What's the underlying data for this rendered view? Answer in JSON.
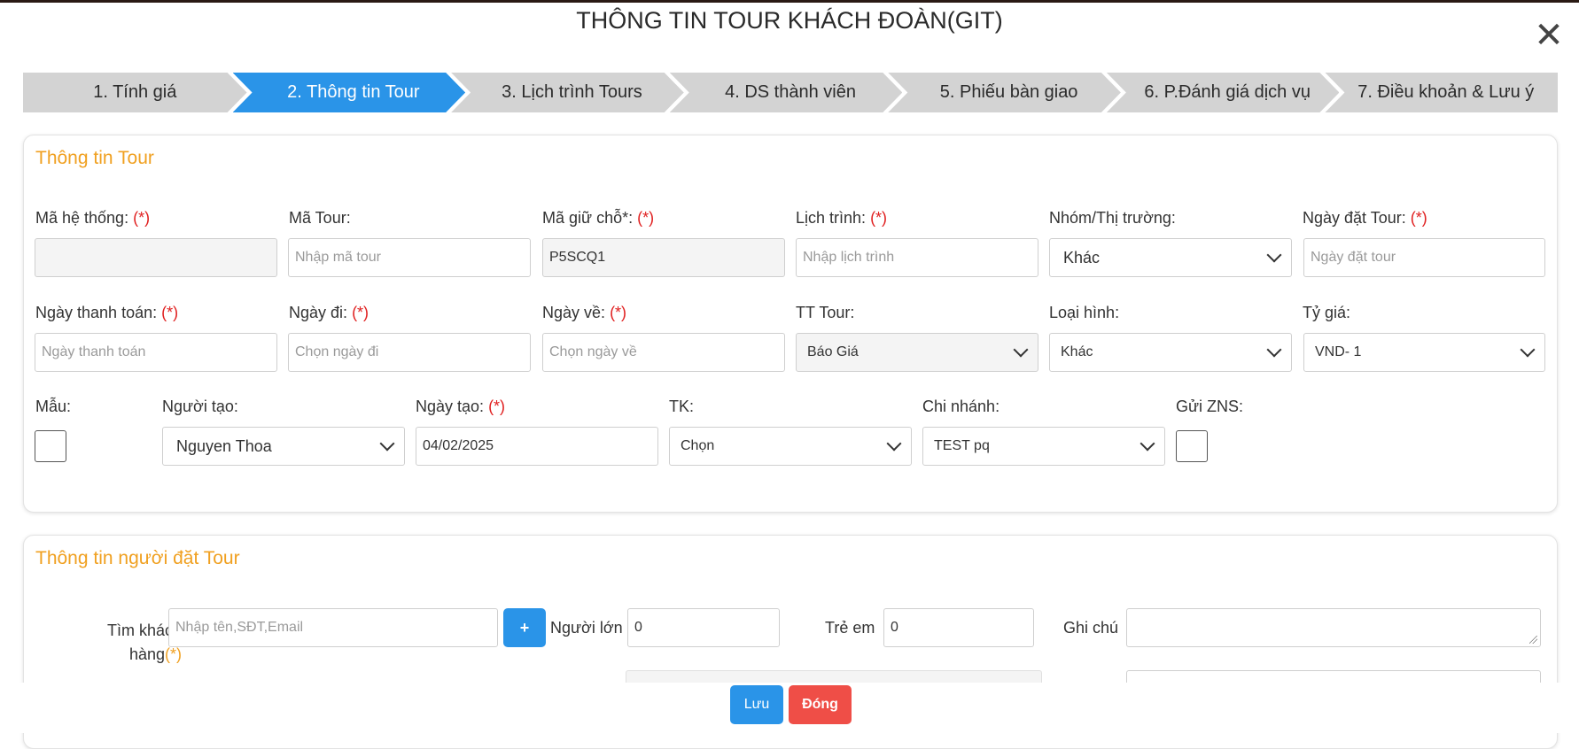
{
  "title": "THÔNG TIN TOUR KHÁCH ĐOÀN(GIT)",
  "close_glyph": "✕",
  "steps": [
    {
      "label": "1. Tính giá"
    },
    {
      "label": "2. Thông tin Tour"
    },
    {
      "label": "3. Lịch trình Tours"
    },
    {
      "label": "4. DS thành viên"
    },
    {
      "label": "5. Phiếu bàn giao"
    },
    {
      "label": "6. P.Đánh giá dịch vụ"
    },
    {
      "label": "7. Điều khoản & Lưu ý"
    }
  ],
  "active_step": 2,
  "required_mark": "(*)",
  "tour_info": {
    "title": "Thông tin Tour",
    "ma_he_thong": {
      "label": "Mã hệ thống:",
      "value": ""
    },
    "ma_tour": {
      "label": "Mã Tour:",
      "placeholder": "Nhập mã tour"
    },
    "ma_giu_cho": {
      "label": "Mã giữ chỗ*:",
      "value": "P5SCQ1"
    },
    "lich_trinh": {
      "label": "Lịch trình:",
      "placeholder": "Nhập lịch trình"
    },
    "nhom_thi_truong": {
      "label": "Nhóm/Thị trường:",
      "value": "Khác"
    },
    "ngay_dat_tour": {
      "label": "Ngày đặt Tour:",
      "placeholder": "Ngày đặt tour"
    },
    "ngay_thanh_toan": {
      "label": "Ngày thanh toán:",
      "placeholder": "Ngày thanh toán"
    },
    "ngay_di": {
      "label": "Ngày đi:",
      "placeholder": "Chọn ngày đi"
    },
    "ngay_ve": {
      "label": "Ngày về:",
      "placeholder": "Chọn ngày về"
    },
    "tt_tour": {
      "label": "TT Tour:",
      "value": "Báo Giá"
    },
    "loai_hinh": {
      "label": "Loại hình:",
      "value": "Khác"
    },
    "ty_gia": {
      "label": "Tỷ giá:",
      "value": "VND- 1"
    },
    "mau": {
      "label": "Mẫu:"
    },
    "nguoi_tao": {
      "label": "Người tạo:",
      "value": "Nguyen Thoa"
    },
    "ngay_tao": {
      "label": "Ngày tạo:",
      "value": "04/02/2025"
    },
    "tk": {
      "label": "TK:",
      "value": "Chọn"
    },
    "chi_nhanh": {
      "label": "Chi nhánh:",
      "value": "TEST pq"
    },
    "gui_zns": {
      "label": "Gửi ZNS:"
    }
  },
  "booker_info": {
    "title": "Thông tin người đặt Tour",
    "tim_khach_hang": {
      "label_line1": "Tìm khách",
      "label_line2": "hàng",
      "placeholder": "Nhập tên,SĐT,Email"
    },
    "plus_label": "+",
    "nguoi_lon": {
      "label": "Người lớn",
      "value": "0"
    },
    "tre_em": {
      "label": "Trẻ em",
      "value": "0"
    },
    "ghi_chu": {
      "label": "Ghi chú"
    }
  },
  "footer": {
    "save_label": "Lưu",
    "close_label": "Đóng"
  }
}
